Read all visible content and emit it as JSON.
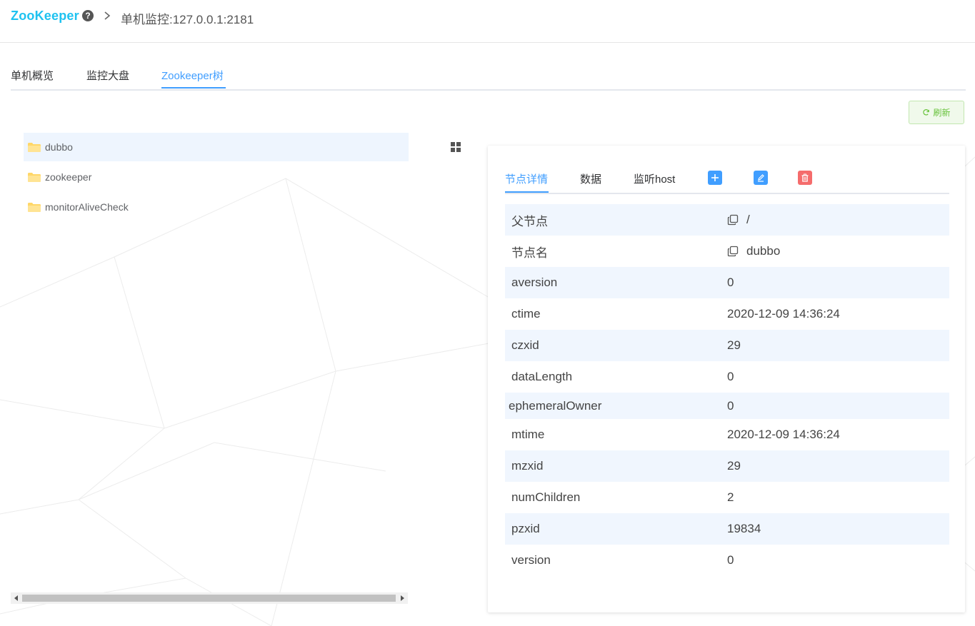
{
  "header": {
    "logo": "ZooKeeper",
    "help_glyph": "?",
    "title": "单机监控:127.0.0.1:2181"
  },
  "tabs": [
    {
      "label": "单机概览",
      "active": false
    },
    {
      "label": "监控大盘",
      "active": false
    },
    {
      "label": "Zookeeper树",
      "active": true
    }
  ],
  "refresh": {
    "label": "刷新",
    "icon": "refresh-icon"
  },
  "tree": {
    "items": [
      {
        "label": "dubbo",
        "selected": true,
        "icon": "folder-icon"
      },
      {
        "label": "zookeeper",
        "selected": false,
        "icon": "folder-icon"
      },
      {
        "label": "monitorAliveCheck",
        "selected": false,
        "icon": "folder-icon"
      }
    ]
  },
  "panel": {
    "tabs": [
      {
        "label": "节点详情",
        "active": true
      },
      {
        "label": "数据",
        "active": false
      },
      {
        "label": "监听host",
        "active": false
      }
    ],
    "tools": [
      {
        "name": "add",
        "icon": "plus-icon",
        "color": "#409eff"
      },
      {
        "name": "edit",
        "icon": "edit-icon",
        "color": "#409eff"
      },
      {
        "name": "delete",
        "icon": "trash-icon",
        "color": "#f56c6c"
      }
    ],
    "rows": [
      {
        "key": "父节点",
        "value": "/",
        "copy": true
      },
      {
        "key": "节点名",
        "value": "dubbo",
        "copy": true
      },
      {
        "key": "aversion",
        "value": "0"
      },
      {
        "key": "ctime",
        "value": "2020-12-09 14:36:24"
      },
      {
        "key": "czxid",
        "value": "29"
      },
      {
        "key": "dataLength",
        "value": "0"
      },
      {
        "key": "ephemeralOwner",
        "value": "0"
      },
      {
        "key": "mtime",
        "value": "2020-12-09 14:36:24"
      },
      {
        "key": "mzxid",
        "value": "29"
      },
      {
        "key": "numChildren",
        "value": "2"
      },
      {
        "key": "pzxid",
        "value": "19834"
      },
      {
        "key": "version",
        "value": "0"
      }
    ]
  },
  "colors": {
    "accent": "#409eff",
    "logo": "#1ec2f0",
    "success": "#67c23a",
    "danger": "#f56c6c",
    "folder": "#ffd768"
  }
}
